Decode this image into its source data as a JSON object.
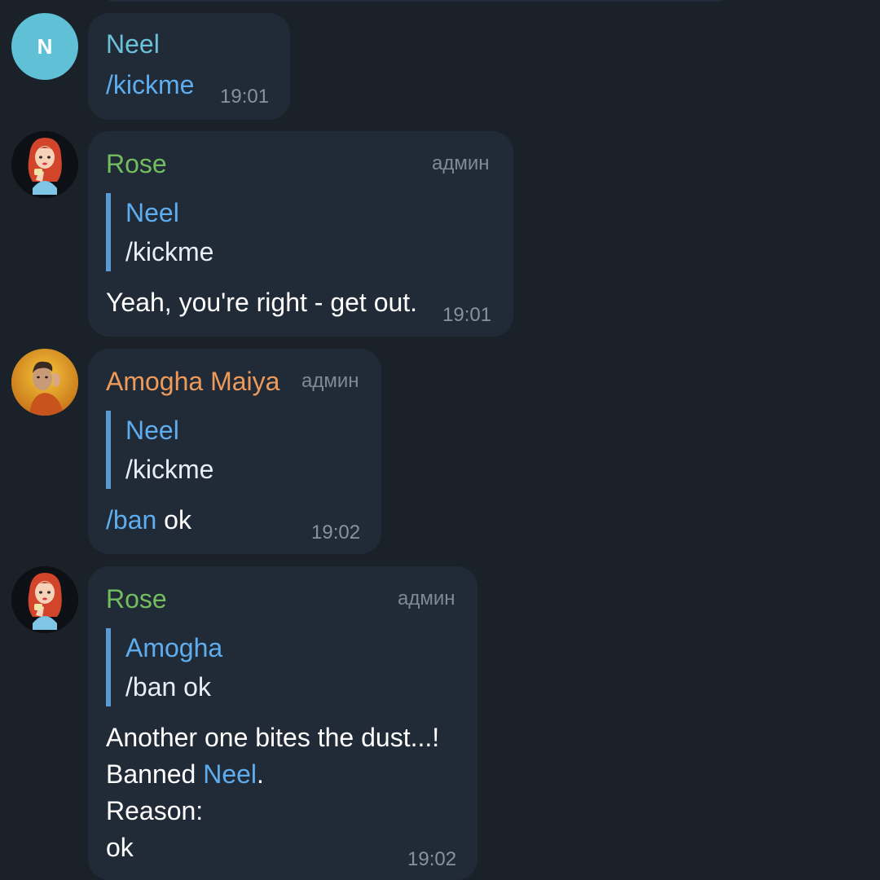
{
  "messages": [
    {
      "sender": "Neel",
      "initial": "N",
      "text": "/kickme",
      "time": "19:01"
    },
    {
      "sender": "Rose",
      "admin": "админ",
      "reply_to": {
        "name": "Neel",
        "text": "/kickme"
      },
      "text": "Yeah, you're right - get out.",
      "time": "19:01"
    },
    {
      "sender": "Amogha Maiya",
      "admin": "админ",
      "reply_to": {
        "name": "Neel",
        "text": "/kickme"
      },
      "command": "/ban",
      "text_rest": " ok",
      "time": "19:02"
    },
    {
      "sender": "Rose",
      "admin": "админ",
      "reply_to": {
        "name": "Amogha",
        "text": "/ban ok"
      },
      "line1": "Another one bites the dust...!",
      "line2_prefix": "Banned ",
      "mention": "Neel",
      "line2_suffix": ".",
      "line3": "Reason:",
      "line4": "ok",
      "time": "19:02"
    }
  ],
  "colors": {
    "background": "#1a2129",
    "bubble": "#212b37",
    "neel_name": "#6bc1d9",
    "rose_name": "#72bd5e",
    "amogha_name": "#ee9a5a",
    "link": "#5eadef",
    "reply_bar": "#5a9bd6",
    "avatar_neel": "#60c0d6"
  },
  "icons": {
    "rose_avatar": "cartoon-redhead-avatar",
    "amogha_avatar": "man-portrait-avatar"
  }
}
